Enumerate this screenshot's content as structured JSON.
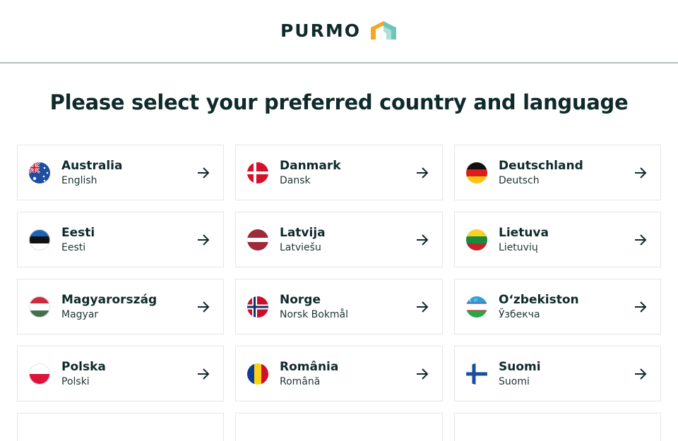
{
  "header": {
    "logo_text": "PURMO",
    "logo_colors": {
      "orange": "#f6a623",
      "teal": "#6cc7b7"
    }
  },
  "page": {
    "title": "Please select your preferred country and language"
  },
  "countries": [
    {
      "country": "Australia",
      "language": "English",
      "flag": "australia-flag"
    },
    {
      "country": "Danmark",
      "language": "Dansk",
      "flag": "denmark-flag"
    },
    {
      "country": "Deutschland",
      "language": "Deutsch",
      "flag": "germany-flag"
    },
    {
      "country": "Eesti",
      "language": "Eesti",
      "flag": "estonia-flag"
    },
    {
      "country": "Latvija",
      "language": "Latviešu",
      "flag": "latvia-flag"
    },
    {
      "country": "Lietuva",
      "language": "Lietuvių",
      "flag": "lithuania-flag"
    },
    {
      "country": "Magyarország",
      "language": "Magyar",
      "flag": "hungary-flag"
    },
    {
      "country": "Norge",
      "language": "Norsk Bokmål",
      "flag": "norway-flag"
    },
    {
      "country": "Oʻzbekiston",
      "language": "Ўзбекча",
      "flag": "uzbekistan-flag"
    },
    {
      "country": "Polska",
      "language": "Polski",
      "flag": "poland-flag"
    },
    {
      "country": "România",
      "language": "Română",
      "flag": "romania-flag"
    },
    {
      "country": "Suomi",
      "language": "Suomi",
      "flag": "finland-flag"
    }
  ],
  "icons": {
    "arrow": "arrow-right-icon"
  },
  "colors": {
    "text": "#0f2a2a",
    "card_border": "#e4e7e7",
    "divider": "#b8bfbf"
  }
}
